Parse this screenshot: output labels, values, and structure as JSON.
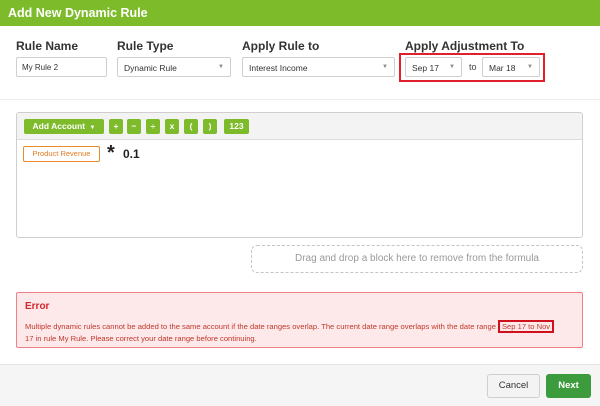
{
  "dialog": {
    "title": "Add New Dynamic Rule"
  },
  "fields": {
    "rule_name": {
      "label": "Rule Name",
      "value": "My Rule 2"
    },
    "rule_type": {
      "label": "Rule Type",
      "value": "Dynamic Rule"
    },
    "apply_rule_to": {
      "label": "Apply Rule to",
      "value": "Interest Income"
    },
    "apply_adjustment_to": {
      "label": "Apply Adjustment To",
      "from": "Sep 17",
      "to_label": "to",
      "to": "Mar 18"
    }
  },
  "toolbar": {
    "add_account": "Add Account",
    "plus": "+",
    "minus": "−",
    "divide": "÷",
    "multiply": "x",
    "open_paren": "(",
    "close_paren": ")",
    "number": "123"
  },
  "formula": {
    "block": "Product Revenue",
    "operator": "*",
    "constant": "0.1"
  },
  "dropzone": {
    "text": "Drag and drop a block here to remove from the formula"
  },
  "error": {
    "title": "Error",
    "message_part1": "Multiple dynamic rules cannot be added to the same account if the date ranges overlap. The current date range overlaps with the date range",
    "highlight_part1": "Sep 17 to Nov",
    "highlight_part2": "17",
    "message_part2": "in rule My Rule. Please correct your date range before continuing."
  },
  "footer": {
    "cancel": "Cancel",
    "next": "Next"
  },
  "colors": {
    "accent": "#7dbb2b",
    "next_button": "#3c9b3c",
    "error_text": "#d5262d",
    "error_bg": "#fde8ea",
    "block_orange": "#e07a1f"
  }
}
